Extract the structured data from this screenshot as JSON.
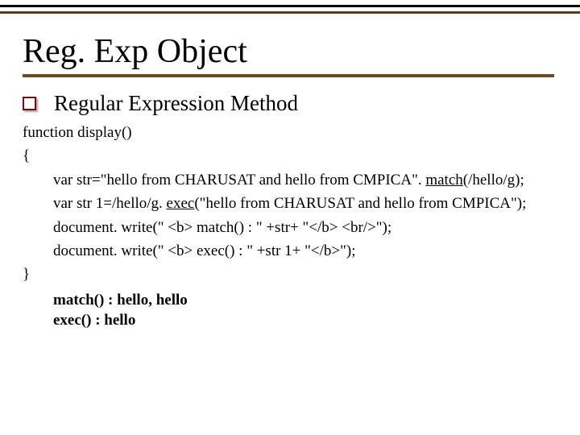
{
  "title": "Reg. Exp Object",
  "bullet": "Regular Expression Method",
  "code": {
    "l1": "function display()",
    "l2": "{",
    "l3a": "var str=\"hello from CHARUSAT and hello from CMPICA\". ",
    "l3b": "match",
    "l3c": "(/hello/g);",
    "l4a": "var str 1=/hello/g. ",
    "l4b": "exec",
    "l4c": "(\"hello from CHARUSAT and hello from CMPICA\");",
    "l5": "document. write(\" <b> match() : \" +str+ \"</b> <br/>\");",
    "l6": "document. write(\" <b> exec() : \" +str 1+ \"</b>\");",
    "l7": "}"
  },
  "output": {
    "o1": "match() : hello, hello",
    "o2": "exec()    : hello"
  }
}
